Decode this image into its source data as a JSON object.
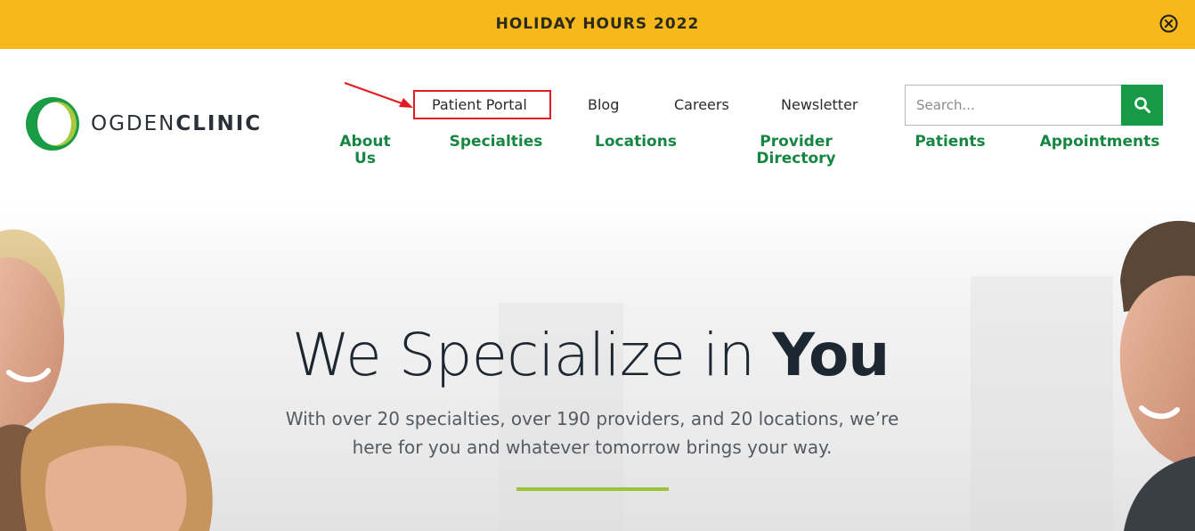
{
  "banner": {
    "title": "HOLIDAY HOURS 2022",
    "close_icon": "close-circle-icon",
    "color": "#f6b81b"
  },
  "header": {
    "logo": {
      "name_light": "OGDEN",
      "name_bold": "CLINIC",
      "mark_icon": "crescent-logo-icon"
    },
    "utility_nav": [
      {
        "label": "Patient Portal"
      },
      {
        "label": "Blog"
      },
      {
        "label": "Careers"
      },
      {
        "label": "Newsletter"
      }
    ],
    "search": {
      "placeholder": "Search...",
      "value": "",
      "button_icon": "search-icon"
    },
    "main_nav": [
      {
        "line1": "About",
        "line2": "Us"
      },
      {
        "line1": "Specialties",
        "line2": ""
      },
      {
        "line1": "Locations",
        "line2": ""
      },
      {
        "line1": "Provider",
        "line2": "Directory"
      },
      {
        "line1": "Patients",
        "line2": ""
      },
      {
        "line1": "Appointments",
        "line2": ""
      }
    ],
    "brand_green": "#168642"
  },
  "hero": {
    "title_light": "We Specialize in ",
    "title_bold": "You",
    "subtitle": "With over 20 specialties, over 190 providers, and 20 locations, we’re here for you and whatever tomorrow brings your way.",
    "accent_color": "#9bc33a"
  }
}
